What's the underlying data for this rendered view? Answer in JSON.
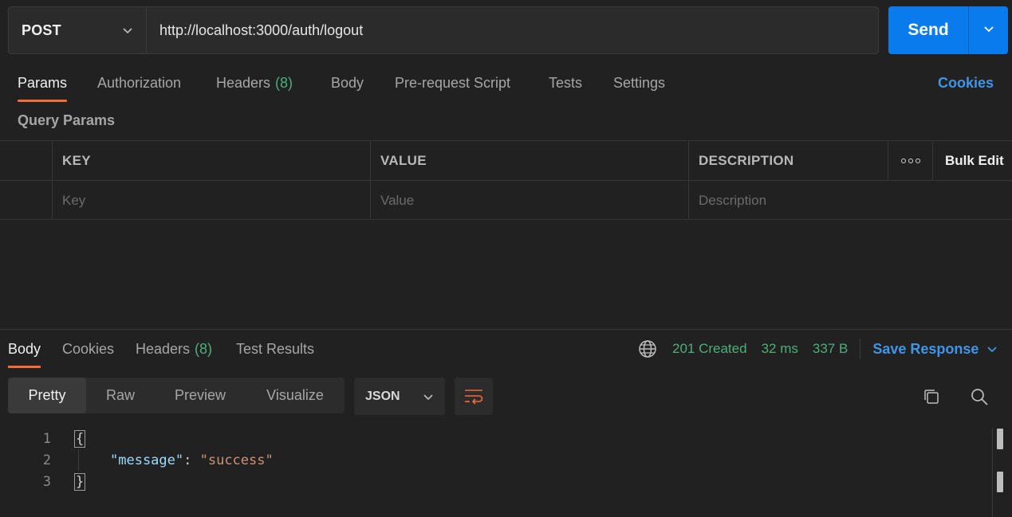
{
  "request": {
    "method": "POST",
    "url": "http://localhost:3000/auth/logout",
    "send_label": "Send"
  },
  "request_tabs": {
    "params": "Params",
    "authorization": "Authorization",
    "headers": "Headers",
    "headers_count": "(8)",
    "body": "Body",
    "pre_request": "Pre-request Script",
    "tests": "Tests",
    "settings": "Settings",
    "cookies": "Cookies"
  },
  "query_params": {
    "title": "Query Params",
    "columns": {
      "key": "KEY",
      "value": "VALUE",
      "description": "DESCRIPTION",
      "bulk_edit": "Bulk Edit"
    },
    "placeholders": {
      "key": "Key",
      "value": "Value",
      "description": "Description"
    }
  },
  "response_tabs": {
    "body": "Body",
    "cookies": "Cookies",
    "headers": "Headers",
    "headers_count": "(8)",
    "test_results": "Test Results"
  },
  "response_status": {
    "status": "201 Created",
    "time": "32 ms",
    "size": "337 B",
    "save_label": "Save Response"
  },
  "view_modes": [
    "Pretty",
    "Raw",
    "Preview",
    "Visualize"
  ],
  "format": "JSON",
  "code_lines": {
    "l1": "1",
    "l2": "2",
    "l3": "3",
    "open_brace": "{",
    "key": "\"message\"",
    "colon": ": ",
    "value": "\"success\"",
    "close_brace": "}"
  },
  "colors": {
    "accent_blue": "#097bed",
    "tab_indicator": "#f26b3a",
    "status_green": "#4caf7a",
    "link_blue": "#3f95e8"
  },
  "icons": [
    "chevron-down-icon",
    "globe-icon",
    "wrap-lines-icon",
    "copy-icon",
    "search-icon",
    "more-dots-icon"
  ]
}
